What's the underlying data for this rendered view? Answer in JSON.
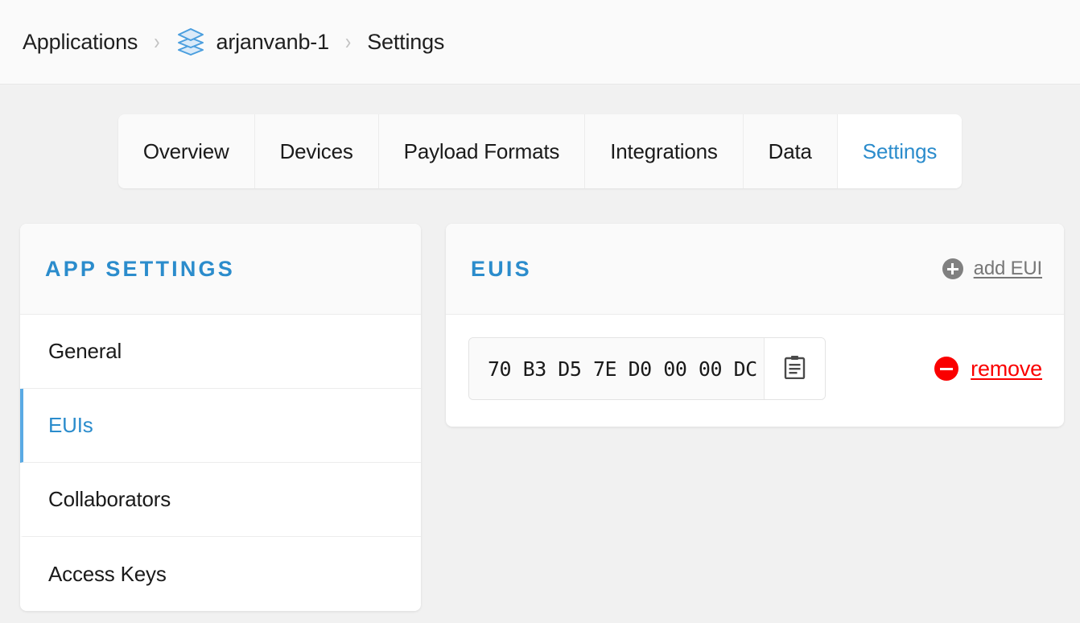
{
  "breadcrumb": {
    "root_label": "Applications",
    "separator": "›",
    "app_label": "arjanvanb-1",
    "app_icon": "layers-stack-icon",
    "current_label": "Settings"
  },
  "tabs": [
    {
      "label": "Overview",
      "active": false
    },
    {
      "label": "Devices",
      "active": false
    },
    {
      "label": "Payload Formats",
      "active": false
    },
    {
      "label": "Integrations",
      "active": false
    },
    {
      "label": "Data",
      "active": false
    },
    {
      "label": "Settings",
      "active": true
    }
  ],
  "sidebar": {
    "title": "APP SETTINGS",
    "items": [
      {
        "label": "General",
        "active": false
      },
      {
        "label": "EUIs",
        "active": true
      },
      {
        "label": "Collaborators",
        "active": false
      },
      {
        "label": "Access Keys",
        "active": false
      }
    ]
  },
  "panel": {
    "title": "EUIS",
    "add_action": {
      "label": "add EUI",
      "icon": "plus-circle-icon"
    },
    "rows": [
      {
        "eui_value": "70 B3 D5 7E D0 00 00 DC",
        "copy_icon": "clipboard-icon",
        "remove_label": "remove",
        "remove_icon": "minus-circle-icon"
      }
    ]
  },
  "colors": {
    "accent_blue": "#2b8ccc",
    "danger_red": "#fa0000",
    "muted_gray": "#808080",
    "page_background": "#f1f1f1",
    "card_background": "#ffffff",
    "header_background": "#fafafa"
  }
}
